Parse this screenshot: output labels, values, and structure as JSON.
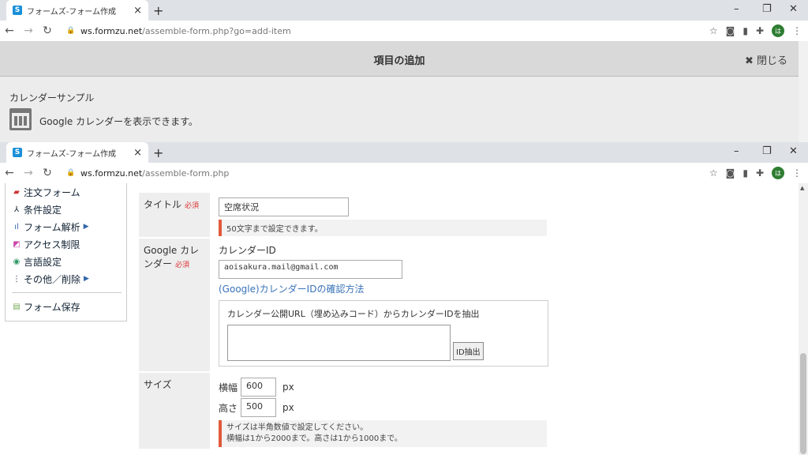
{
  "window1": {
    "tab_icon": "S",
    "tab_title": "フォームズ-フォーム作成",
    "tab_close": "×",
    "new_tab": "+",
    "min": "–",
    "max": "❐",
    "close": "✕",
    "url_host": "ws.formzu.net",
    "url_path": "/assemble-form.php?go=add-item",
    "avatar": "は"
  },
  "overlay": {
    "title": "項目の追加",
    "close_label": "閉じる",
    "sample_title": "カレンダーサンプル",
    "sample_desc": "Google カレンダーを表示できます。"
  },
  "window2": {
    "tab_icon": "S",
    "tab_title": "フォームズ-フォーム作成",
    "tab_close": "×",
    "new_tab": "+",
    "min": "–",
    "max": "❐",
    "close": "✕",
    "url_host": "ws.formzu.net",
    "url_path": "/assemble-form.php",
    "avatar": "は"
  },
  "sidebar": {
    "items": [
      {
        "icon": "cart-icon",
        "label": "注文フォーム",
        "arrow": ""
      },
      {
        "icon": "condition-icon",
        "label": "条件設定",
        "arrow": ""
      },
      {
        "icon": "analytics-icon",
        "label": "フォーム解析",
        "arrow": "▶"
      },
      {
        "icon": "access-icon",
        "label": "アクセス制限",
        "arrow": ""
      },
      {
        "icon": "globe-icon",
        "label": "言語設定",
        "arrow": ""
      },
      {
        "icon": "more-icon",
        "label": "その他／削除",
        "arrow": "▶"
      }
    ],
    "save_label": "フォーム保存"
  },
  "form": {
    "title_label": "タイトル",
    "required": "必須",
    "title_value": "空席状況",
    "title_hint": "50文字まで設定できます。",
    "gcal_label": "Google カレンダー",
    "cal_id_label": "カレンダーID",
    "cal_id_value": "aoisakura.mail@gmail.com",
    "cal_id_link": "(Google)カレンダーIDの確認方法",
    "extract_label": "カレンダー公開URL（埋め込みコード）からカレンダーIDを抽出",
    "extract_button": "ID抽出",
    "size_label": "サイズ",
    "width_label": "横幅",
    "width_value": "600",
    "height_label": "高さ",
    "height_value": "500",
    "unit": "px",
    "size_hint1": "サイズは半角数値で設定してください。",
    "size_hint2": "横幅は1から2000まで。高さは1から1000まで。"
  },
  "colors": {
    "required": "#dd3333",
    "hint_bar": "#e05a3a",
    "link": "#3a73b8"
  }
}
